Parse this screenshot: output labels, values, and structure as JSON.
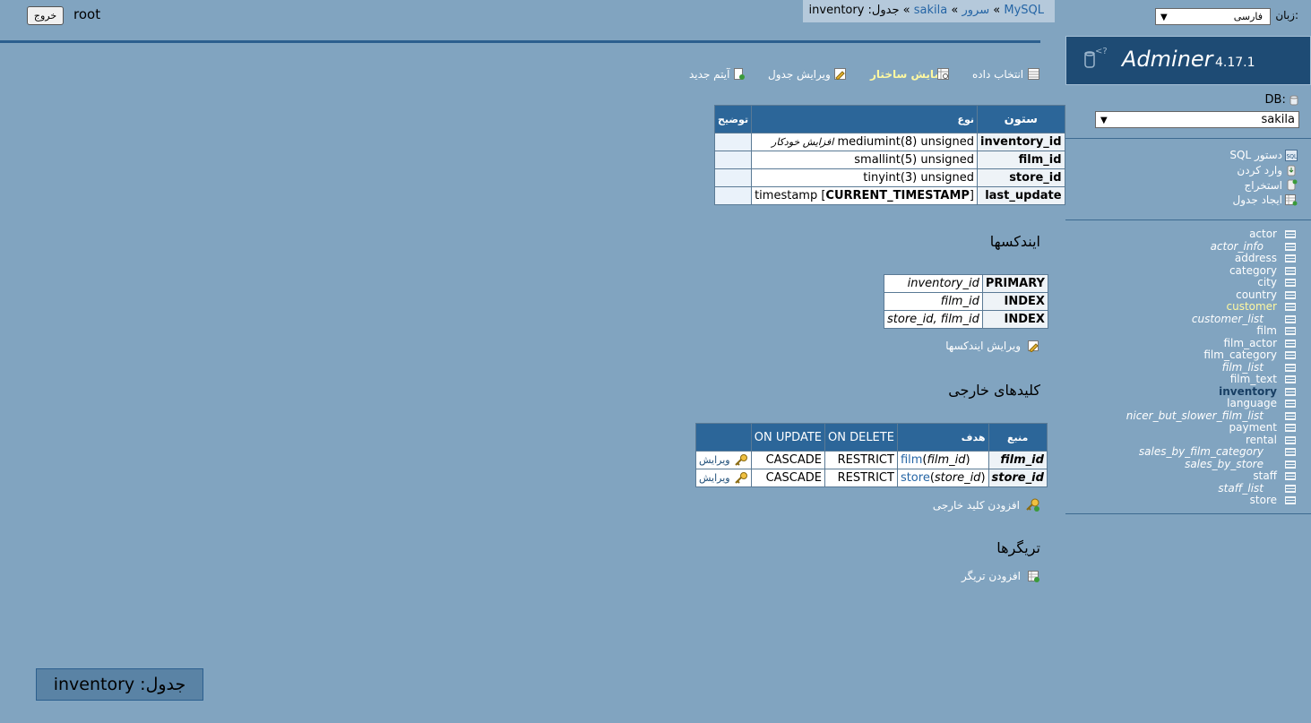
{
  "header": {
    "logout_label": "خروج",
    "user": "root",
    "breadcrumb": {
      "driver": "MySQL",
      "server": "سرور",
      "db": "sakila",
      "table_prefix": "جدول:",
      "table": "inventory",
      "sep": "»"
    }
  },
  "sidebar": {
    "lang_label": "زبان:",
    "lang_value": "فارسی",
    "logo": "Adminer",
    "version": "4.17.1",
    "db_label": "DB:",
    "db_value": "sakila",
    "links": [
      {
        "label": "دستور SQL",
        "icon": "sql-icon"
      },
      {
        "label": "وارد کردن",
        "icon": "import-icon"
      },
      {
        "label": "استخراج",
        "icon": "export-icon"
      },
      {
        "label": "ایجاد جدول",
        "icon": "create-table-icon"
      }
    ],
    "tables": [
      {
        "name": "actor",
        "view": false
      },
      {
        "name": "actor_info",
        "view": true
      },
      {
        "name": "address",
        "view": false
      },
      {
        "name": "category",
        "view": false
      },
      {
        "name": "city",
        "view": false
      },
      {
        "name": "country",
        "view": false
      },
      {
        "name": "customer",
        "view": false,
        "active": true
      },
      {
        "name": "customer_list",
        "view": true
      },
      {
        "name": "film",
        "view": false
      },
      {
        "name": "film_actor",
        "view": false
      },
      {
        "name": "film_category",
        "view": false
      },
      {
        "name": "film_list",
        "view": true
      },
      {
        "name": "film_text",
        "view": false
      },
      {
        "name": "inventory",
        "view": false,
        "current": true
      },
      {
        "name": "language",
        "view": false
      },
      {
        "name": "nicer_but_slower_film_list",
        "view": true
      },
      {
        "name": "payment",
        "view": false
      },
      {
        "name": "rental",
        "view": false
      },
      {
        "name": "sales_by_film_category",
        "view": true
      },
      {
        "name": "sales_by_store",
        "view": true
      },
      {
        "name": "staff",
        "view": false
      },
      {
        "name": "staff_list",
        "view": true
      },
      {
        "name": "store",
        "view": false
      }
    ]
  },
  "actions": {
    "select_data": "انتخاب داده",
    "show_structure": "نمایش ساختار",
    "alter_table": "ویرایش جدول",
    "new_item": "آیتم جدید"
  },
  "columns_table": {
    "headers": {
      "column": "ستون",
      "type": "نوع",
      "comment": "توضیح"
    },
    "rows": [
      {
        "name": "inventory_id",
        "type": "mediumint(8) unsigned",
        "extra": "افزایش خودکار",
        "comment": ""
      },
      {
        "name": "film_id",
        "type": "smallint(5) unsigned",
        "extra": "",
        "comment": ""
      },
      {
        "name": "store_id",
        "type": "tinyint(3) unsigned",
        "extra": "",
        "comment": ""
      },
      {
        "name": "last_update",
        "type": "timestamp [",
        "default": "CURRENT_TIMESTAMP",
        "type_end": "]",
        "comment": ""
      }
    ]
  },
  "indexes": {
    "title": "ایندکسها",
    "rows": [
      {
        "type": "PRIMARY",
        "cols": "inventory_id"
      },
      {
        "type": "INDEX",
        "cols": "film_id"
      },
      {
        "type": "INDEX",
        "cols": "store_id, film_id"
      }
    ],
    "edit_label": "ویرایش ایندکسها"
  },
  "foreign_keys": {
    "title": "کلیدهای خارجی",
    "headers": {
      "source": "منبع",
      "target": "هدف",
      "on_delete": "ON DELETE",
      "on_update": "ON UPDATE"
    },
    "rows": [
      {
        "source": "film_id",
        "target_table": "film",
        "target_col": "film_id",
        "on_delete": "RESTRICT",
        "on_update": "CASCADE",
        "edit": "ویرایش"
      },
      {
        "source": "store_id",
        "target_table": "store",
        "target_col": "store_id",
        "on_delete": "RESTRICT",
        "on_update": "CASCADE",
        "edit": "ویرایش"
      }
    ],
    "add_label": "افزودن کلید خارجی"
  },
  "triggers": {
    "title": "تریگرها",
    "add_label": "افزودن تریگر"
  },
  "footer": {
    "title": "جدول: inventory"
  }
}
